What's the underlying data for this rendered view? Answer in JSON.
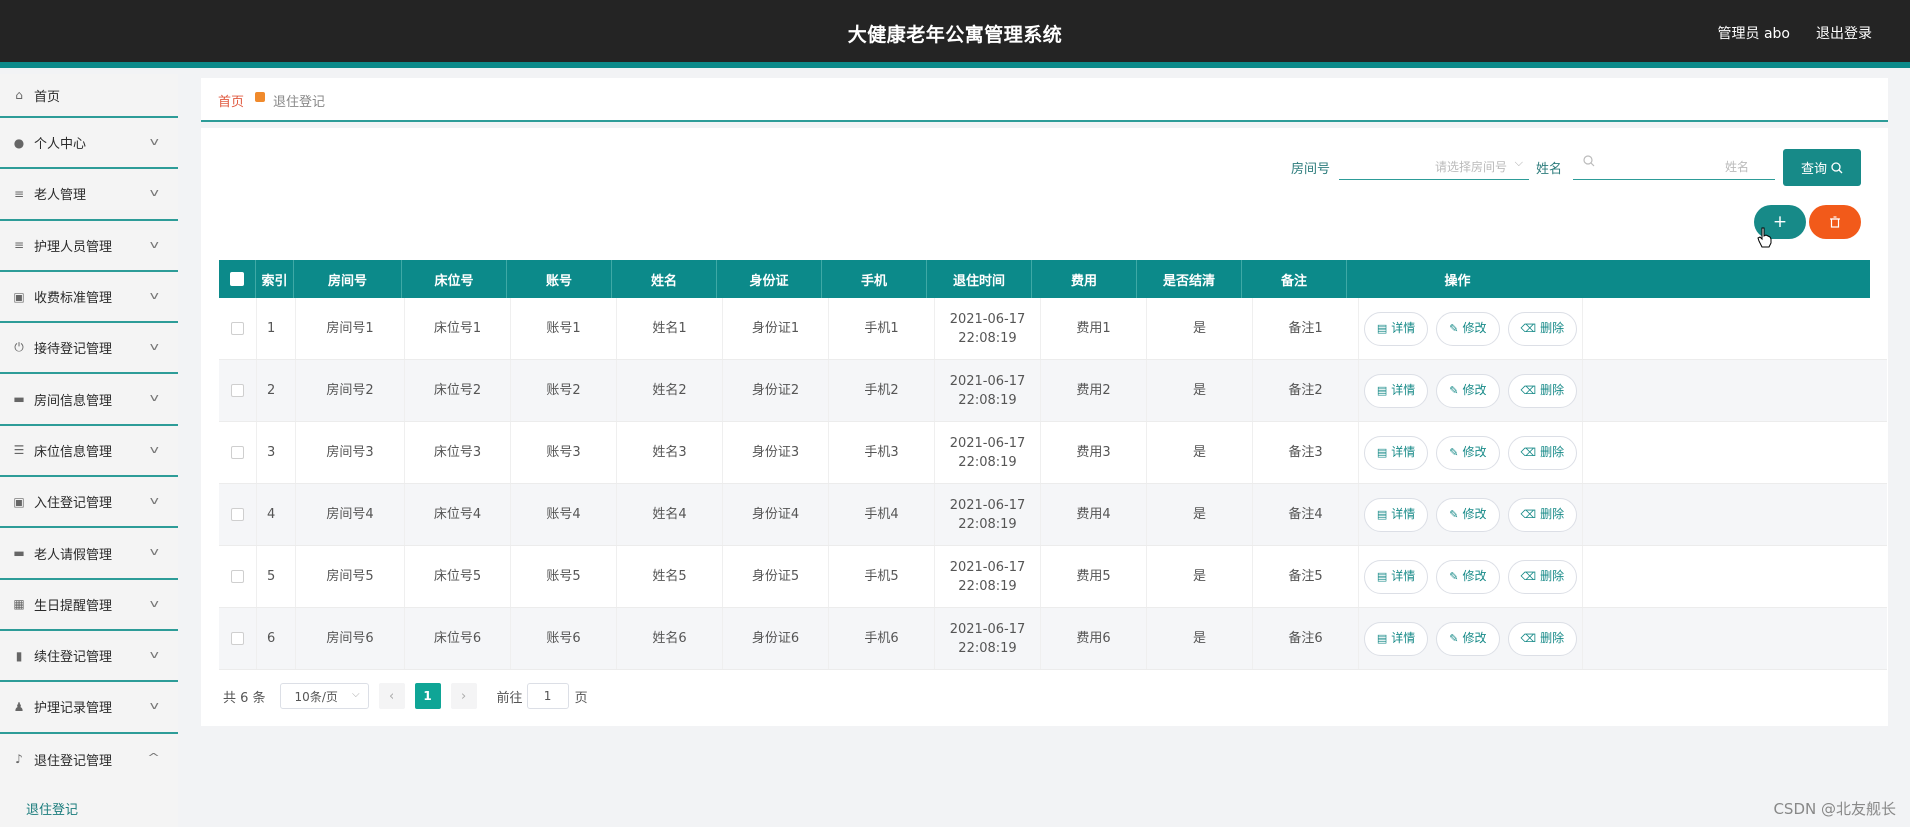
{
  "header": {
    "title": "大健康老年公寓管理系统",
    "user": "管理员 abo",
    "logout": "退出登录"
  },
  "sidebar": {
    "items": [
      {
        "label": "首页",
        "icon": "home-icon"
      },
      {
        "label": "个人中心",
        "icon": "user-icon"
      },
      {
        "label": "老人管理",
        "icon": "menu-icon"
      },
      {
        "label": "护理人员管理",
        "icon": "menu-icon"
      },
      {
        "label": "收费标准管理",
        "icon": "clipboard-icon"
      },
      {
        "label": "接待登记管理",
        "icon": "power-icon"
      },
      {
        "label": "房间信息管理",
        "icon": "monitor-icon"
      },
      {
        "label": "床位信息管理",
        "icon": "sliders-icon"
      },
      {
        "label": "入住登记管理",
        "icon": "clipboard-icon"
      },
      {
        "label": "老人请假管理",
        "icon": "bed-icon"
      },
      {
        "label": "生日提醒管理",
        "icon": "grid-icon"
      },
      {
        "label": "续住登记管理",
        "icon": "bar-chart-icon"
      },
      {
        "label": "护理记录管理",
        "icon": "person-icon"
      },
      {
        "label": "退住登记管理",
        "icon": "mic-icon"
      }
    ],
    "sub_item": "退住登记"
  },
  "breadcrumb": {
    "home": "首页",
    "current": "退住登记"
  },
  "search": {
    "room_label": "房间号",
    "room_placeholder": "请选择房间号",
    "name_label": "姓名",
    "name_placeholder": "姓名",
    "query_button": "查询"
  },
  "table": {
    "headers": [
      "索引",
      "房间号",
      "床位号",
      "账号",
      "姓名",
      "身份证",
      "手机",
      "退住时间",
      "费用",
      "是否结清",
      "备注",
      "操作"
    ],
    "rows": [
      {
        "idx": "1",
        "room": "房间号1",
        "bed": "床位号1",
        "account": "账号1",
        "name": "姓名1",
        "id": "身份证1",
        "phone": "手机1",
        "time": "2021-06-17 22:08:19",
        "fee": "费用1",
        "settled": "是",
        "note": "备注1"
      },
      {
        "idx": "2",
        "room": "房间号2",
        "bed": "床位号2",
        "account": "账号2",
        "name": "姓名2",
        "id": "身份证2",
        "phone": "手机2",
        "time": "2021-06-17 22:08:19",
        "fee": "费用2",
        "settled": "是",
        "note": "备注2"
      },
      {
        "idx": "3",
        "room": "房间号3",
        "bed": "床位号3",
        "account": "账号3",
        "name": "姓名3",
        "id": "身份证3",
        "phone": "手机3",
        "time": "2021-06-17 22:08:19",
        "fee": "费用3",
        "settled": "是",
        "note": "备注3"
      },
      {
        "idx": "4",
        "room": "房间号4",
        "bed": "床位号4",
        "account": "账号4",
        "name": "姓名4",
        "id": "身份证4",
        "phone": "手机4",
        "time": "2021-06-17 22:08:19",
        "fee": "费用4",
        "settled": "是",
        "note": "备注4"
      },
      {
        "idx": "5",
        "room": "房间号5",
        "bed": "床位号5",
        "account": "账号5",
        "name": "姓名5",
        "id": "身份证5",
        "phone": "手机5",
        "time": "2021-06-17 22:08:19",
        "fee": "费用5",
        "settled": "是",
        "note": "备注5"
      },
      {
        "idx": "6",
        "room": "房间号6",
        "bed": "床位号6",
        "account": "账号6",
        "name": "姓名6",
        "id": "身份证6",
        "phone": "手机6",
        "time": "2021-06-17 22:08:19",
        "fee": "费用6",
        "settled": "是",
        "note": "备注6"
      }
    ],
    "actions": {
      "detail": "详情",
      "edit": "修改",
      "delete": "删除"
    }
  },
  "pagination": {
    "total": "共 6 条",
    "page_size": "10条/页",
    "current_page": "1",
    "goto_label": "前往",
    "goto_value": "1",
    "page_suffix": "页"
  },
  "watermark": "CSDN @北友舰长",
  "colors": {
    "accent": "#0c8a8a",
    "danger": "#f25a1a",
    "header_bg": "#242424"
  }
}
